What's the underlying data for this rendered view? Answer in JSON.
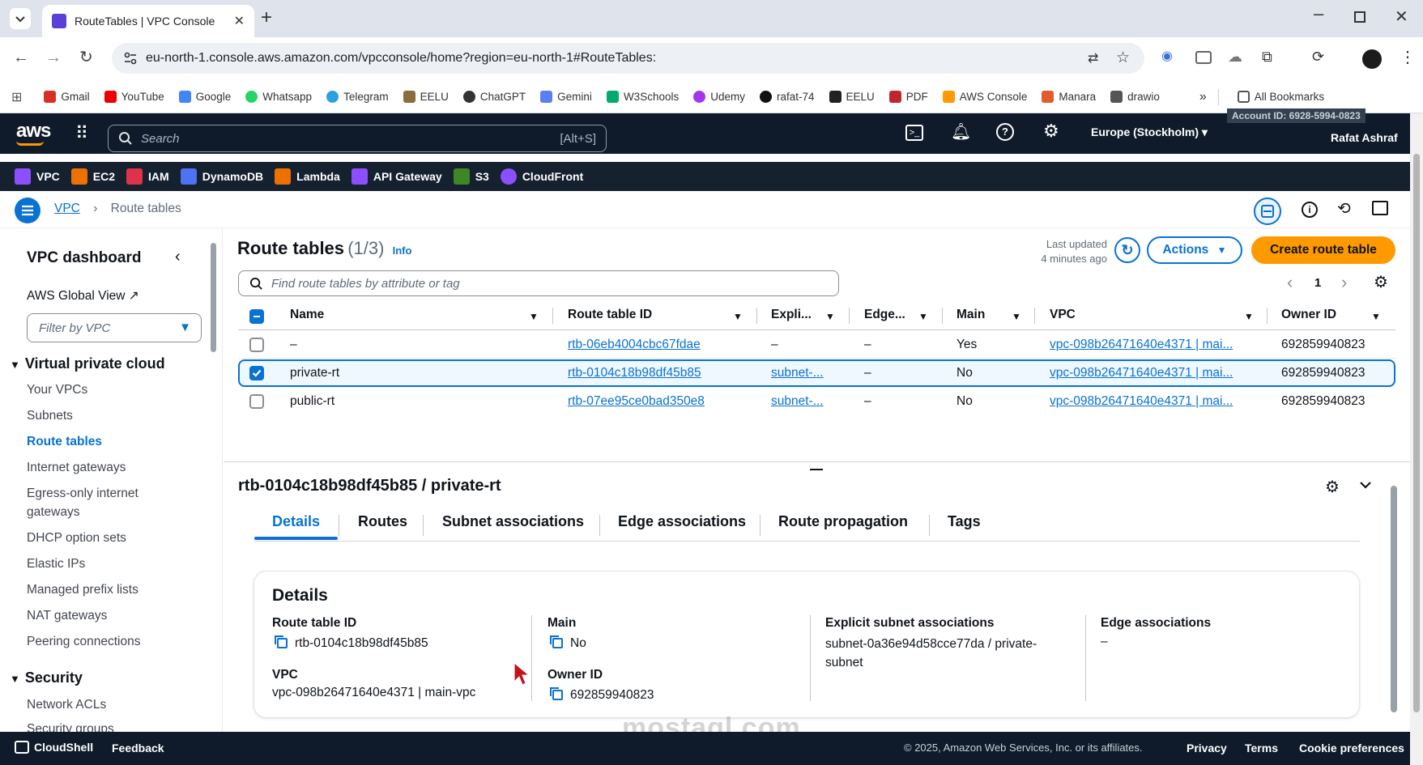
{
  "browser": {
    "tab_title": "RouteTables | VPC Console",
    "url": "eu-north-1.console.aws.amazon.com/vpcconsole/home?region=eu-north-1#RouteTables:",
    "bookmarks": [
      "Gmail",
      "YouTube",
      "Google",
      "Whatsapp",
      "Telegram",
      "EELU",
      "ChatGPT",
      "Gemini",
      "W3Schools",
      "Udemy",
      "rafat-74",
      "EELU",
      "PDF",
      "AWS Console",
      "Manara",
      "drawio"
    ],
    "all_bookmarks": "All Bookmarks"
  },
  "aws": {
    "logo": "aws",
    "search_placeholder": "Search",
    "search_shortcut": "[Alt+S]",
    "region": "Europe (Stockholm)",
    "account_id": "Account ID: 6928-5994-0823",
    "user": "Rafat Ashraf",
    "services": [
      "VPC",
      "EC2",
      "IAM",
      "DynamoDB",
      "Lambda",
      "API Gateway",
      "S3",
      "CloudFront"
    ]
  },
  "breadcrumb": {
    "root": "VPC",
    "current": "Route tables"
  },
  "sidenav": {
    "title": "VPC dashboard",
    "global_view": "AWS Global View",
    "filter_placeholder": "Filter by VPC",
    "section1": "Virtual private cloud",
    "items": [
      "Your VPCs",
      "Subnets",
      "Route tables",
      "Internet gateways",
      "Egress-only internet",
      "gateways",
      "DHCP option sets",
      "Elastic IPs",
      "Managed prefix lists",
      "NAT gateways",
      "Peering connections"
    ],
    "section2": "Security",
    "items2": [
      "Network ACLs",
      "Security groups"
    ]
  },
  "list": {
    "title": "Route tables",
    "count": "(1/3)",
    "info": "Info",
    "last_updated_label": "Last updated",
    "last_updated_value": "4 minutes ago",
    "actions": "Actions",
    "create": "Create route table",
    "filter_placeholder": "Find route tables by attribute or tag",
    "page": "1",
    "columns": [
      "Name",
      "Route table ID",
      "Expli...",
      "Edge...",
      "Main",
      "VPC",
      "Owner ID"
    ],
    "rows": [
      {
        "name": "–",
        "id": "rtb-06eb4004cbc67fdae",
        "explicit": "–",
        "edge": "–",
        "main": "Yes",
        "vpc": "vpc-098b26471640e4371 | mai...",
        "owner": "692859940823"
      },
      {
        "name": "private-rt",
        "id": "rtb-0104c18b98df45b85",
        "explicit": "subnet-...",
        "edge": "–",
        "main": "No",
        "vpc": "vpc-098b26471640e4371 | mai...",
        "owner": "692859940823"
      },
      {
        "name": "public-rt",
        "id": "rtb-07ee95ce0bad350e8",
        "explicit": "subnet-...",
        "edge": "–",
        "main": "No",
        "vpc": "vpc-098b26471640e4371 | mai...",
        "owner": "692859940823"
      }
    ]
  },
  "detail": {
    "title": "rtb-0104c18b98df45b85 / private-rt",
    "tabs": [
      "Details",
      "Routes",
      "Subnet associations",
      "Edge associations",
      "Route propagation",
      "Tags"
    ],
    "card_title": "Details",
    "route_table_id_label": "Route table ID",
    "route_table_id": "rtb-0104c18b98df45b85",
    "vpc_label": "VPC",
    "vpc": "vpc-098b26471640e4371 | main-vpc",
    "main_label": "Main",
    "main": "No",
    "owner_label": "Owner ID",
    "owner": "692859940823",
    "explicit_label": "Explicit subnet associations",
    "explicit_line1": "subnet-0a36e94d58cce77da / private-",
    "explicit_line2": "subnet",
    "edge_label": "Edge associations",
    "edge": "–"
  },
  "footer": {
    "cloudshell": "CloudShell",
    "feedback": "Feedback",
    "copyright": "© 2025, Amazon Web Services, Inc. or its affiliates.",
    "privacy": "Privacy",
    "terms": "Terms",
    "cookies": "Cookie preferences"
  },
  "watermark": "mostaql.com",
  "colors": {
    "accent": "#0972d3",
    "primary_button": "#ff9900",
    "header": "#0f1b2a"
  }
}
